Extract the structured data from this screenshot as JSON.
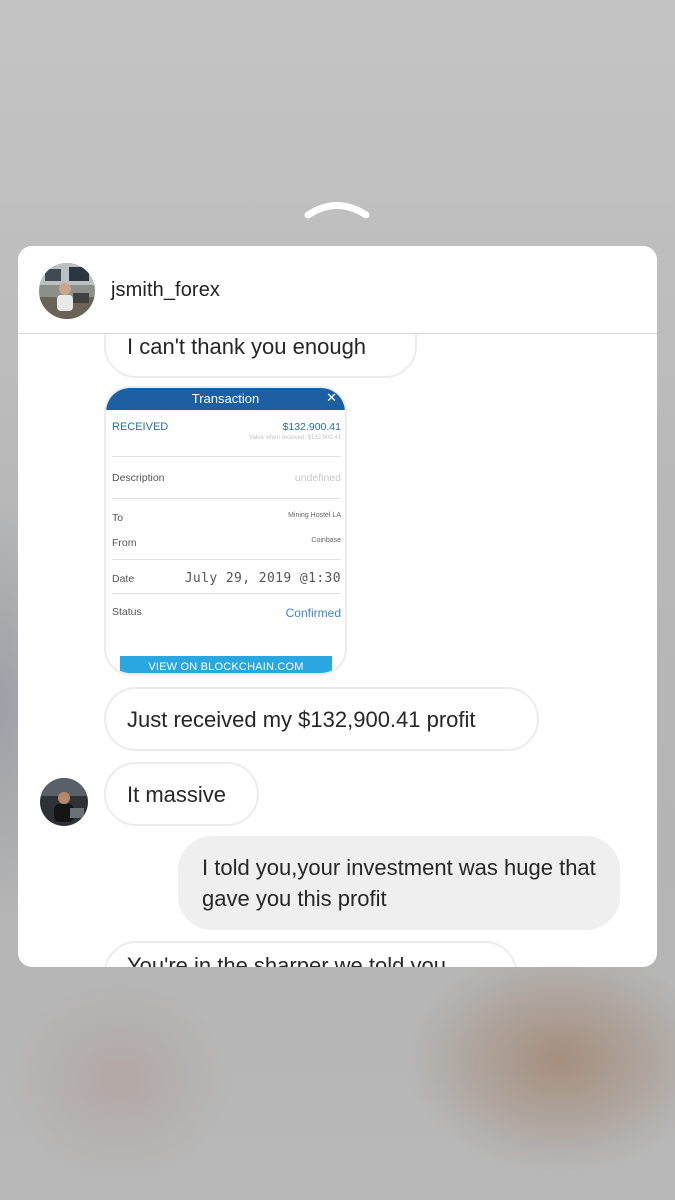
{
  "header": {
    "username": "jsmith_forex"
  },
  "messages": {
    "thanks": "I can't thank you enough",
    "received_profit": "Just received my $132,900.41 profit",
    "massive": "It massive",
    "outgoing": "I told you,your investment was huge that gave you this profit",
    "cut_off": "You're in the sharper we told you"
  },
  "transaction": {
    "title": "Transaction",
    "close_icon": "close-icon",
    "received_label": "RECEIVED",
    "received_value": "$132.900.41",
    "received_sub": "Value when received: $132,900.41",
    "description_label": "Description",
    "description_value": "undefined",
    "to_label": "To",
    "to_value": "Mining Hostel LA",
    "from_label": "From",
    "from_value": "Coinbase",
    "date_label": "Date",
    "date_value": "July 29, 2019 @1:30",
    "status_label": "Status",
    "status_value": "Confirmed",
    "button_label": "VIEW ON BLOCKCHAIN.COM"
  },
  "colors": {
    "tx_header": "#1c5fa2",
    "tx_button": "#2aa7e0",
    "outgoing_bubble": "#efefef"
  },
  "icons": {
    "swipe_up": "chevron-up-icon"
  }
}
